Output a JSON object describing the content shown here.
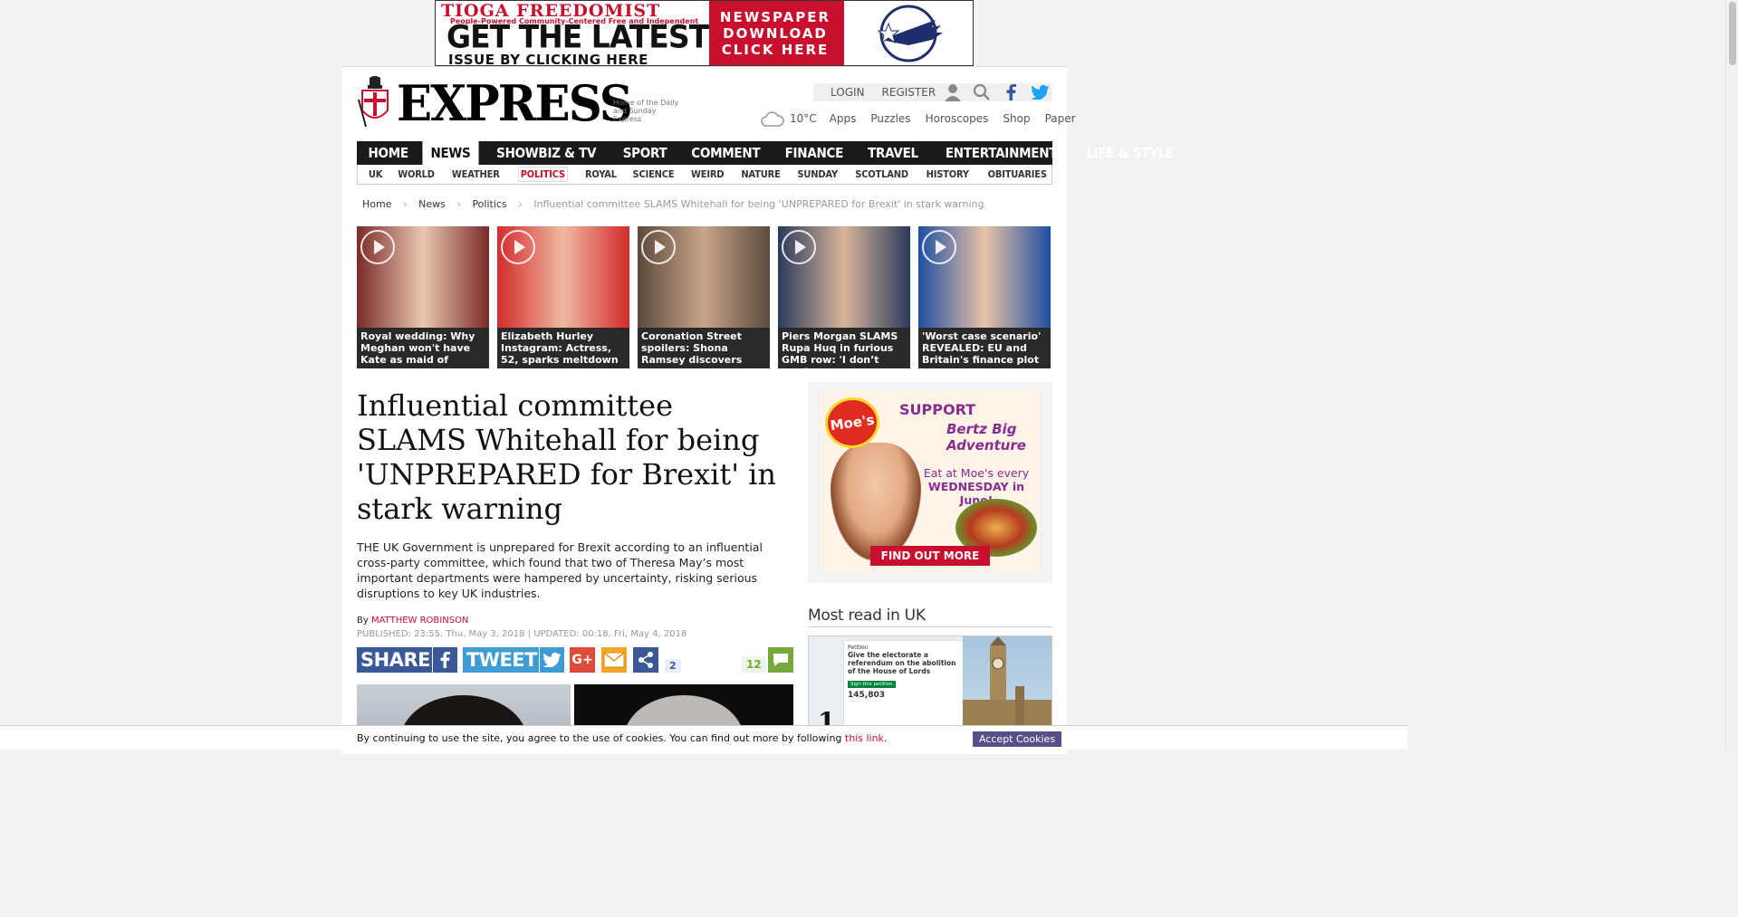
{
  "top_ad": {
    "brand": "TIOGA FREEDOMIST",
    "tagline": "People-Powered   Community-Centered   Free and Independent",
    "headline_1": "GET THE LATEST",
    "headline_2": "ISSUE BY CLICKING HERE",
    "cta_lines": [
      "NEWSPAPER",
      "DOWNLOAD",
      "CLICK HERE"
    ]
  },
  "header": {
    "logo_text": "EXPRESS",
    "logo_sub": "Home of the Daily and Sunday Express",
    "login": "LOGIN",
    "register": "REGISTER",
    "weather_temp": "10°C",
    "links": [
      "Apps",
      "Puzzles",
      "Horoscopes",
      "Shop",
      "Paper"
    ]
  },
  "nav": {
    "items": [
      "HOME",
      "NEWS",
      "SHOWBIZ & TV",
      "SPORT",
      "COMMENT",
      "FINANCE",
      "TRAVEL",
      "ENTERTAINMENT",
      "LIFE & STYLE"
    ],
    "active": "NEWS"
  },
  "subnav": {
    "items": [
      "UK",
      "WORLD",
      "WEATHER",
      "POLITICS",
      "ROYAL",
      "SCIENCE",
      "WEIRD",
      "NATURE",
      "SUNDAY",
      "SCOTLAND",
      "HISTORY",
      "OBITUARIES"
    ],
    "active": "POLITICS"
  },
  "breadcrumb": {
    "items": [
      "Home",
      "News",
      "Politics"
    ],
    "current": "Influential committee SLAMS Whitehall for being 'UNPREPARED for Brexit' in stark warning"
  },
  "videos": [
    {
      "caption": "Royal wedding: Why Meghan won't have Kate as maid of",
      "colors": [
        "#7a2a2a",
        "#e9c7b0"
      ]
    },
    {
      "caption": "Elizabeth Hurley Instagram: Actress, 52, sparks meltdown",
      "colors": [
        "#d22b2b",
        "#f0b8a0"
      ]
    },
    {
      "caption": "Coronation Street spoilers: Shona Ramsey discovers",
      "colors": [
        "#5b4a3c",
        "#c9a48a"
      ]
    },
    {
      "caption": "Piers Morgan SLAMS Rupa Huq in furious GMB row: 'I don’t want",
      "colors": [
        "#2a3a5a",
        "#d8b59a"
      ]
    },
    {
      "caption": "'Worst case scenario' REVEALED: EU and Britain's finance plot",
      "colors": [
        "#1f4fa0",
        "#e8c2a8"
      ]
    }
  ],
  "article": {
    "headline": "Influential committee SLAMS Whitehall for being 'UNPREPARED for Brexit' in stark warning",
    "lede": "THE UK Government is unprepared for Brexit according to an influential cross-party committee, which found that two of Theresa May’s most important departments were hampered by uncertainty, risking serious disruptions to key UK industries.",
    "by": "By",
    "author": "MATTHEW ROBINSON",
    "dateline": "PUBLISHED: 23:55, Thu, May 3, 2018 | UPDATED: 00:18, Fri, May 4, 2018"
  },
  "share": {
    "share_label": "SHARE",
    "tweet_label": "TWEET",
    "share_count": "2",
    "comment_count": "12"
  },
  "rail": {
    "ad": {
      "logo": "Moe's",
      "support": "SUPPORT",
      "bertz": "Bertz Big Adventure",
      "eat_line_1": "Eat at Moe's every",
      "eat_line_2": "WEDNESDAY in June!",
      "cta": "FIND OUT MORE"
    },
    "most_read_title": "Most read in UK",
    "most_read_1": {
      "rank": "1",
      "petition_label": "Petition",
      "petition_title": "Give the electorate a referendum on the abolition of the House of Lords",
      "petition_button": "Sign this petition",
      "petition_count": "145,803"
    }
  },
  "cookie": {
    "text": "By continuing to use the site, you agree to the use of cookies. You can find out more by following",
    "link": "this link",
    "accept": "Accept Cookies"
  }
}
